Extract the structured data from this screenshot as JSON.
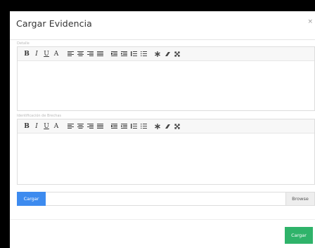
{
  "modal": {
    "title": "Cargar Evidencia",
    "close": "×"
  },
  "editor1": {
    "label": "Detalle"
  },
  "editor2": {
    "label": "Identificación de Brechas"
  },
  "toolbar": {
    "bold": "B",
    "italic": "I",
    "underline": "U",
    "font": "A"
  },
  "upload": {
    "button_label": "Cargar",
    "browse_label": "Browse"
  },
  "footer": {
    "submit_label": "Cargar"
  }
}
